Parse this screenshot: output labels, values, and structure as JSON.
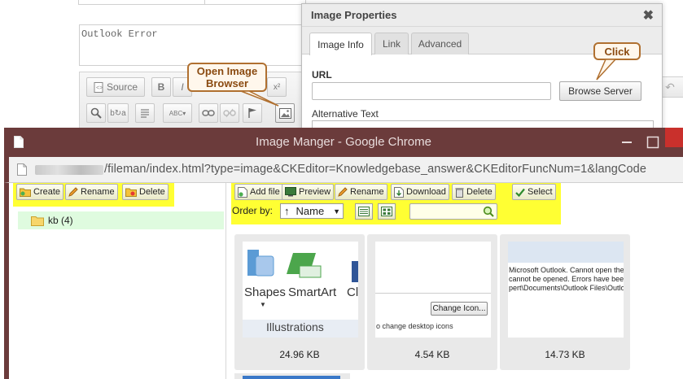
{
  "editor": {
    "body_text": "Outlook Error",
    "source_label": "Source"
  },
  "dialog": {
    "title": "Image Properties",
    "close_glyph": "✖",
    "tabs": [
      {
        "label": "Image Info",
        "active": true
      },
      {
        "label": "Link",
        "active": false
      },
      {
        "label": "Advanced",
        "active": false
      }
    ],
    "url_label": "URL",
    "url_value": "",
    "browse_label": "Browse Server",
    "alt_label": "Alternative Text"
  },
  "callouts": {
    "open_browser": "Open Image Browser",
    "click": "Click"
  },
  "chrome": {
    "title": "Image Manger - Google Chrome",
    "address": "/fileman/index.html?type=image&CKEditor=Knowledgebase_answer&CKEditorFuncNum=1&langCode"
  },
  "fileman": {
    "left_toolbar": {
      "create": "Create",
      "rename": "Rename",
      "delete": "Delete"
    },
    "tree": [
      {
        "label": "kb (4)"
      }
    ],
    "toolbar": {
      "add_file": "Add file",
      "preview": "Preview",
      "rename": "Rename",
      "download": "Download",
      "delete": "Delete",
      "select": "Select"
    },
    "order_by_label": "Order by:",
    "order_by_value": "Name",
    "order_arrow": "↑",
    "files": [
      {
        "size": "24.96 KB",
        "labels": [
          "Shapes",
          "SmartArt",
          "Cl",
          "Illustrations"
        ]
      },
      {
        "size": "4.54 KB",
        "button": "Change Icon...",
        "caption": "o change desktop icons"
      },
      {
        "size": "14.73 KB",
        "lines": [
          "Microsoft Outlook. Cannot open the Out",
          "cannot be opened. Errors have been dete",
          "pert\\Documents\\Outlook Files\\Outlook.p"
        ]
      }
    ]
  },
  "colors": {
    "chrome_title_bg": "#6b3b3b",
    "highlight": "#ffff33",
    "tree_selected_bg": "#dffbdf",
    "callout_border": "#b07030",
    "window_close": "#c9302c"
  }
}
